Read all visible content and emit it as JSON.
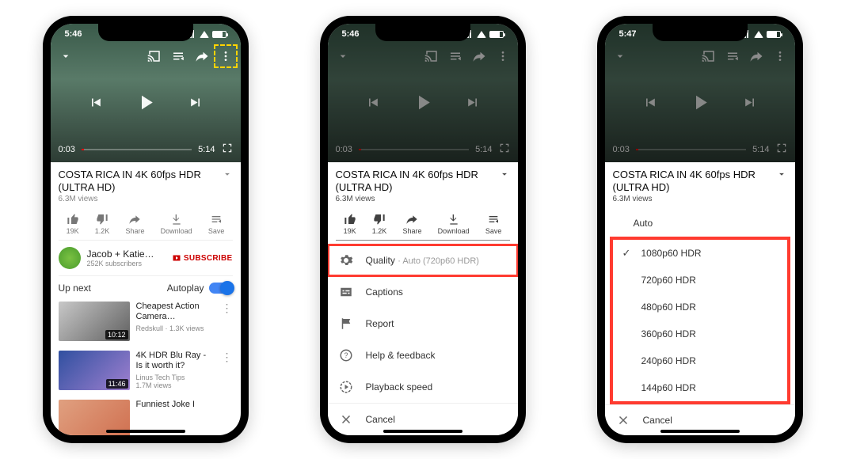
{
  "status": {
    "time1": "5:46",
    "time2": "5:46",
    "time3": "5:47",
    "loc": "◂"
  },
  "video": {
    "title": "COSTA RICA IN 4K 60fps HDR (ULTRA HD)",
    "views": "6.3M views",
    "elapsed": "0:03",
    "duration": "5:14"
  },
  "actions": {
    "likes": "19K",
    "dislikes": "1.2K",
    "share": "Share",
    "download": "Download",
    "save": "Save"
  },
  "channel": {
    "name": "Jacob + Katie…",
    "subs": "252K subscribers",
    "subscribe": "SUBSCRIBE"
  },
  "upnext": {
    "label": "Up next",
    "autoplay": "Autoplay"
  },
  "related": [
    {
      "title": "Cheapest Action Camera…",
      "meta": "Redskull · 1.3K views",
      "dur": "10:12"
    },
    {
      "title": "4K HDR Blu Ray - Is it worth it?",
      "meta": "Linus Tech Tips\n1.7M views",
      "dur": "11:46"
    },
    {
      "title": "Funniest Joke I",
      "meta": "",
      "dur": ""
    }
  ],
  "sheet": {
    "quality": "Quality",
    "quality_current": "· Auto (720p60 HDR)",
    "captions": "Captions",
    "report": "Report",
    "help": "Help & feedback",
    "speed": "Playback speed",
    "cancel": "Cancel"
  },
  "quality_options": {
    "auto": "Auto",
    "opts": [
      "1080p60 HDR",
      "720p60 HDR",
      "480p60 HDR",
      "360p60 HDR",
      "240p60 HDR",
      "144p60 HDR"
    ],
    "selected": "1080p60 HDR",
    "cancel": "Cancel"
  }
}
